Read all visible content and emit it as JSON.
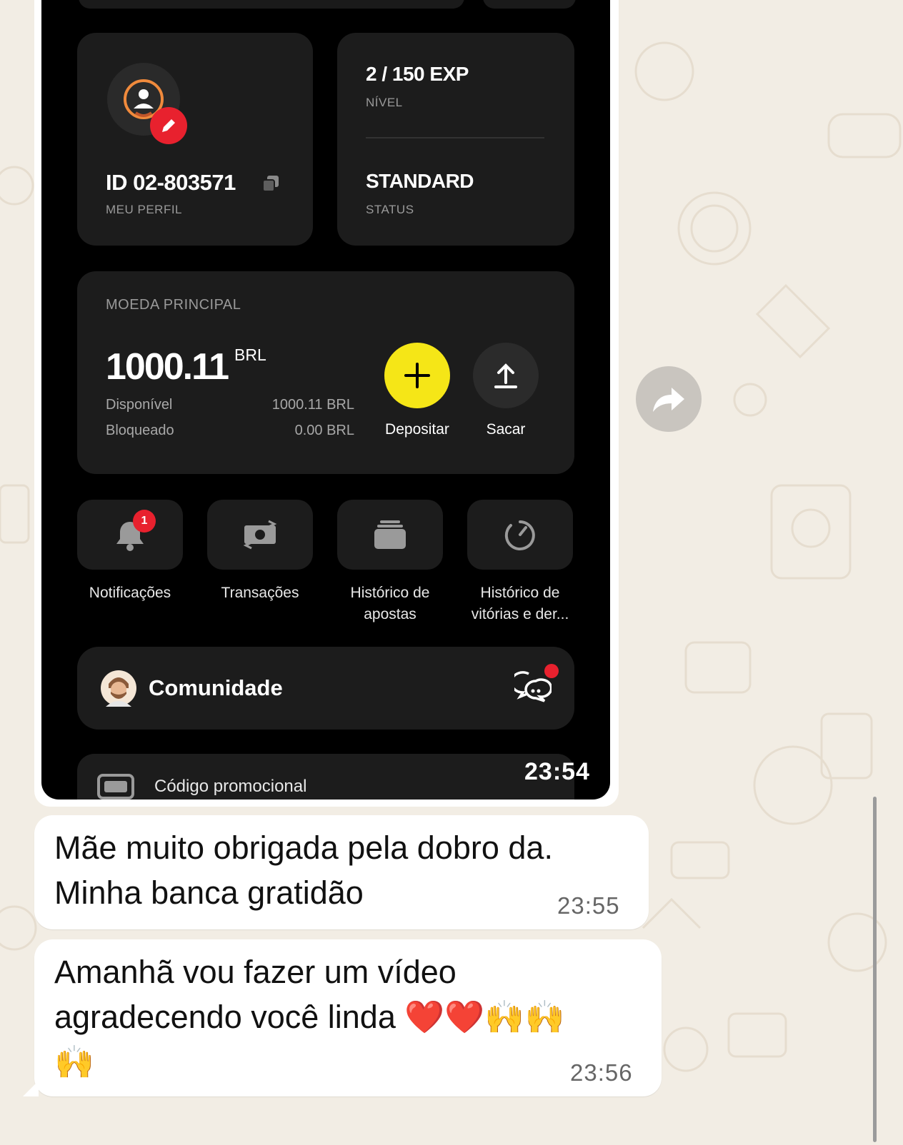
{
  "profile_card": {
    "id_label": "ID 02-803571",
    "caption": "MEU PERFIL"
  },
  "level_card": {
    "exp": "2 / 150 EXP",
    "exp_caption": "NÍVEL",
    "status": "STANDARD",
    "status_caption": "STATUS"
  },
  "balance_card": {
    "caption": "MOEDA PRINCIPAL",
    "amount": "1000.11",
    "currency": "BRL",
    "available_label": "Disponível",
    "available_value": "1000.11 BRL",
    "blocked_label": "Bloqueado",
    "blocked_value": "0.00 BRL",
    "deposit_label": "Depositar",
    "withdraw_label": "Sacar",
    "deposit_color": "#f5e617"
  },
  "menu_tiles": [
    {
      "label": "Notificações",
      "icon": "bell-icon",
      "badge": "1"
    },
    {
      "label": "Transações",
      "icon": "money-exchange-icon"
    },
    {
      "label": "Histórico de apostas",
      "icon": "stack-icon"
    },
    {
      "label": "Histórico de vitórias e der...",
      "icon": "timer-icon"
    }
  ],
  "community": {
    "title": "Comunidade",
    "icon": "chat-icon"
  },
  "promo": {
    "label": "Código promocional",
    "icon": "ticket-icon"
  },
  "image_time": "23:54",
  "messages": [
    {
      "text_line1": "Mãe muito obrigada pela dobro da.",
      "text_line2": "Minha banca gratidão",
      "time": "23:55"
    },
    {
      "text_line1": "Amanhã vou fazer um vídeo",
      "text_line2": "agradecendo você linda ❤️❤️🙌🙌",
      "text_line3": "🙌",
      "time": "23:56"
    }
  ],
  "accent_red": "#e8212e"
}
